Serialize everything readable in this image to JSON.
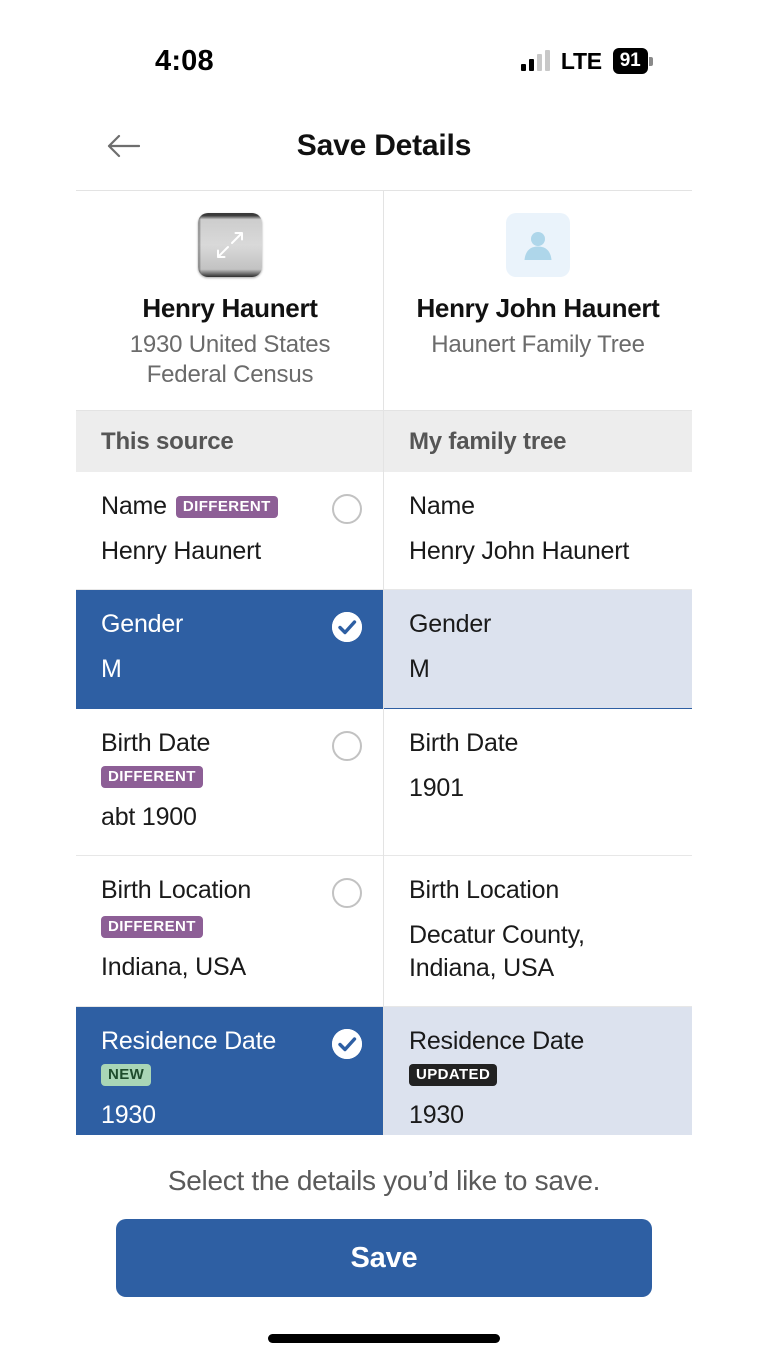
{
  "status_bar": {
    "time": "4:08",
    "network": "LTE",
    "battery": "91",
    "signal_icon": "cellular-signal-icon",
    "battery_icon": "battery-icon"
  },
  "header": {
    "title": "Save Details",
    "back_icon": "back-arrow-icon"
  },
  "compare": {
    "source_card": {
      "name": "Henry Haunert",
      "subtitle": "1930 United States Federal Census",
      "thumbnail_icon": "document-expand-icon"
    },
    "tree_card": {
      "name": "Henry John Haunert",
      "subtitle": "Haunert Family Tree",
      "thumbnail_icon": "person-avatar-icon"
    },
    "column_headers": {
      "left": "This source",
      "right": "My family tree"
    },
    "rows": [
      {
        "left_label": "Name",
        "left_badge": "DIFFERENT",
        "left_badge_type": "different",
        "left_badge_wrap": false,
        "left_value": "Henry Haunert",
        "right_label": "Name",
        "right_badge": "",
        "right_badge_type": "",
        "right_value": "Henry John Haunert",
        "selected": false
      },
      {
        "left_label": "Gender",
        "left_badge": "",
        "left_badge_type": "",
        "left_badge_wrap": false,
        "left_value": "M",
        "right_label": "Gender",
        "right_badge": "",
        "right_badge_type": "",
        "right_value": "M",
        "selected": true
      },
      {
        "left_label": "Birth Date",
        "left_badge": "DIFFERENT",
        "left_badge_type": "different",
        "left_badge_wrap": false,
        "left_value": "abt 1900",
        "right_label": "Birth Date",
        "right_badge": "",
        "right_badge_type": "",
        "right_value": "1901",
        "selected": false
      },
      {
        "left_label": "Birth Location",
        "left_badge": "DIFFERENT",
        "left_badge_type": "different",
        "left_badge_wrap": true,
        "left_value": "Indiana, USA",
        "right_label": "Birth Location",
        "right_badge": "",
        "right_badge_type": "",
        "right_value": "Decatur County, Indiana, USA",
        "selected": false
      },
      {
        "left_label": "Residence Date",
        "left_badge": "NEW",
        "left_badge_type": "new",
        "left_badge_wrap": false,
        "left_value": "1930",
        "right_label": "Residence Date",
        "right_badge": "UPDATED",
        "right_badge_type": "updated",
        "right_value": "1930",
        "selected": true
      }
    ]
  },
  "footer": {
    "hint": "Select the details you’d like to save.",
    "save_label": "Save"
  },
  "colors": {
    "selected_blue": "#2e5fa3",
    "selected_right": "#dce2ee",
    "badge_different": "#8d5f96",
    "badge_new_bg": "#a9d6b6",
    "badge_updated_bg": "#222222",
    "header_bar": "#ededed"
  }
}
